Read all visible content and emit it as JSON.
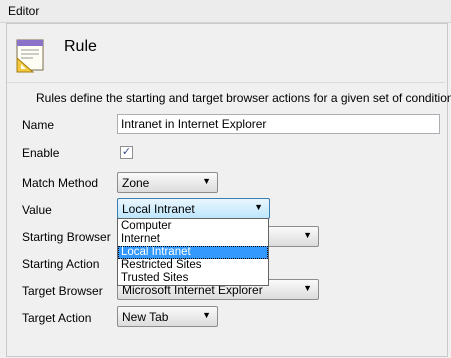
{
  "window": {
    "title": "Editor"
  },
  "header": {
    "title": "Rule",
    "icon": "rule-document-icon"
  },
  "description": "Rules define the starting and target browser actions for a given set of conditions.",
  "form": {
    "name": {
      "label": "Name",
      "value": "Intranet in Internet Explorer"
    },
    "enable": {
      "label": "Enable",
      "checked": true,
      "mark": "✓"
    },
    "match_method": {
      "label": "Match Method",
      "value": "Zone"
    },
    "value": {
      "label": "Value",
      "selected": "Local Intranet",
      "options": [
        "Computer",
        "Internet",
        "Local Intranet",
        "Restricted Sites",
        "Trusted Sites"
      ]
    },
    "starting_browser": {
      "label": "Starting Browser",
      "value": ""
    },
    "starting_action": {
      "label": "Starting Action"
    },
    "target_browser": {
      "label": "Target Browser",
      "value": "Microsoft Internet Explorer"
    },
    "target_action": {
      "label": "Target Action",
      "value": "New Tab"
    }
  },
  "icons": {
    "dropdown": "▼"
  },
  "colors": {
    "selection": "#3399ff",
    "focus_border": "#3c7fb1"
  }
}
